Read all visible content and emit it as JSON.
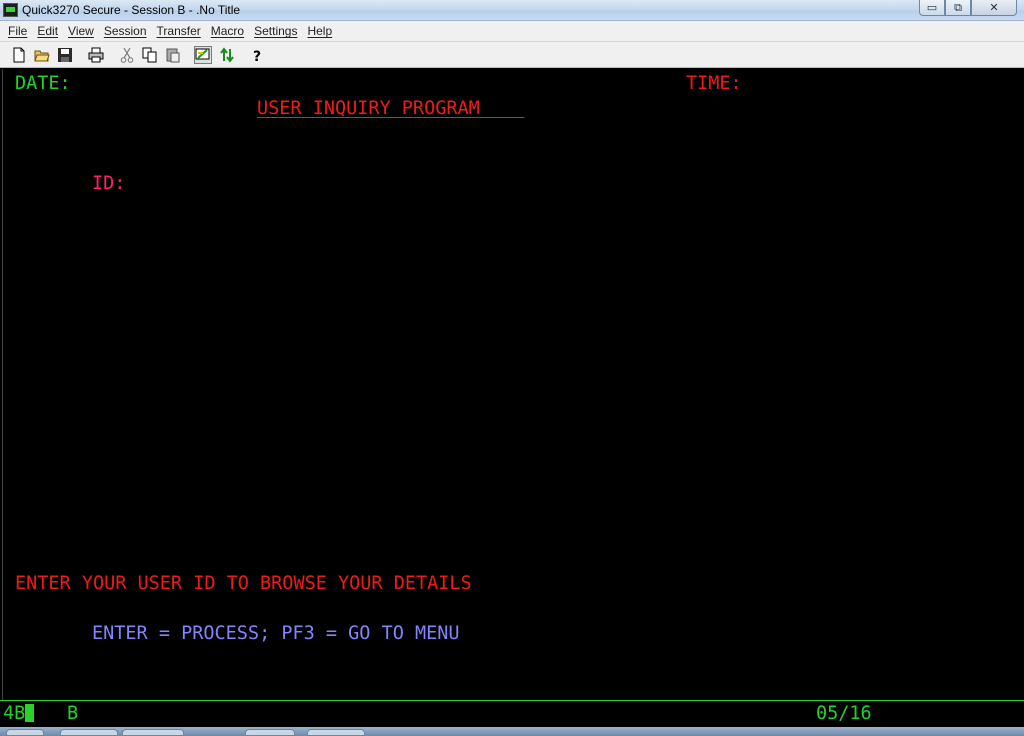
{
  "window": {
    "title": "Quick3270 Secure - Session B - .No Title",
    "min_glyph": "▭",
    "max_glyph": "⧉",
    "close_glyph": "✕"
  },
  "menu": {
    "items": [
      "File",
      "Edit",
      "View",
      "Session",
      "Transfer",
      "Macro",
      "Settings",
      "Help"
    ]
  },
  "toolbar": {
    "icons": [
      "new-document-icon",
      "open-folder-icon",
      "save-icon",
      "print-icon",
      "cut-icon",
      "copy-icon",
      "paste-icon",
      "connect-icon",
      "transfer-arrows-icon",
      "help-icon"
    ]
  },
  "screen": {
    "date_label": "DATE:",
    "time_label": "TIME:",
    "program_title": "USER INQUIRY PROGRAM    ",
    "id_label": "ID:",
    "message": "ENTER YOUR USER ID TO BROWSE YOUR DETAILS",
    "keys_hint": "ENTER = PROCESS; PF3 = GO TO MENU"
  },
  "status": {
    "session_code": "4B",
    "session_id": "B",
    "cursor_pos": "05/16"
  },
  "colors": {
    "field_green": "#22d12a",
    "field_red": "#f01a1a",
    "field_pink": "#ff1f6b",
    "field_blue": "#8484ff"
  }
}
